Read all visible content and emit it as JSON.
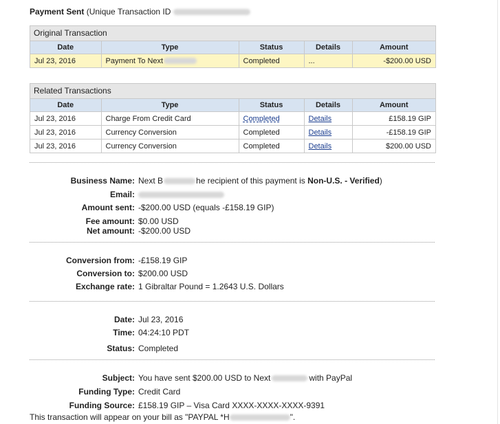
{
  "heading": {
    "label": "Payment Sent",
    "tx_prefix": "(Unique Transaction ID"
  },
  "original": {
    "title": "Original Transaction",
    "columns": [
      "Date",
      "Type",
      "Status",
      "Details",
      "Amount"
    ],
    "row": {
      "date": "Jul 23, 2016",
      "type": "Payment To Next",
      "status": "Completed",
      "details": "...",
      "amount": "-$200.00 USD"
    }
  },
  "related": {
    "title": "Related Transactions",
    "columns": [
      "Date",
      "Type",
      "Status",
      "Details",
      "Amount"
    ],
    "rows": [
      {
        "date": "Jul 23, 2016",
        "type": "Charge From Credit Card",
        "status": "Completed",
        "details": "Details",
        "amount": "£158.19 GIP"
      },
      {
        "date": "Jul 23, 2016",
        "type": "Currency Conversion",
        "status": "Completed",
        "details": "Details",
        "amount": "-£158.19 GIP"
      },
      {
        "date": "Jul 23, 2016",
        "type": "Currency Conversion",
        "status": "Completed",
        "details": "Details",
        "amount": "$200.00 USD"
      }
    ]
  },
  "business": {
    "name_label": "Business Name:",
    "name_start": "Next B",
    "name_tail": "he recipient of this payment is",
    "verified": "Non-U.S. - Verified",
    "email_label": "Email:",
    "amount_sent_label": "Amount sent:",
    "amount_sent": "-$200.00 USD (equals -£158.19 GIP)",
    "fee_label": "Fee amount:",
    "fee": "$0.00 USD",
    "net_label": "Net amount:",
    "net": "-$200.00 USD"
  },
  "conversion": {
    "from_label": "Conversion from:",
    "from": "-£158.19 GIP",
    "to_label": "Conversion to:",
    "to": "$200.00 USD",
    "rate_label": "Exchange rate:",
    "rate": "1 Gibraltar Pound = 1.2643 U.S. Dollars"
  },
  "meta": {
    "date_label": "Date:",
    "date": "Jul 23, 2016",
    "time_label": "Time:",
    "time": "04:24:10 PDT",
    "status_label": "Status:",
    "status": "Completed"
  },
  "funding": {
    "subject_label": "Subject:",
    "subject_start": "You have sent $200.00 USD to Next",
    "subject_end": "with PayPal",
    "type_label": "Funding Type:",
    "type": "Credit Card",
    "source_label": "Funding Source:",
    "source": "£158.19 GIP – Visa Card XXXX-XXXX-XXXX-9391"
  },
  "footer": {
    "start": "This transaction will appear on your bill as \"PAYPAL *H",
    "end": "\"."
  }
}
